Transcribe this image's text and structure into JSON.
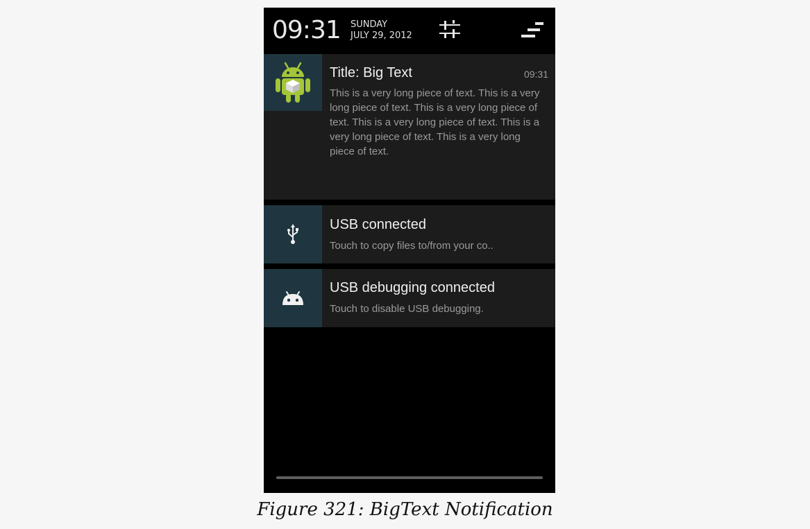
{
  "status_header": {
    "time": "09:31",
    "day": "SUNDAY",
    "date": "JULY 29, 2012",
    "settings_icon": "quick-settings-sliders-icon",
    "clear_icon": "clear-all-icon"
  },
  "notifications": [
    {
      "icon": "android-app-icon",
      "title": "Title: Big Text",
      "time": "09:31",
      "text": "This is a very long piece of text. This is a very long piece of text. This is a very long piece of text. This is a very long piece of text. This is a very long piece of text. This is a very long piece of text."
    },
    {
      "icon": "usb-icon",
      "title": "USB connected",
      "text": "Touch to copy files to/from your co.."
    },
    {
      "icon": "android-debug-icon",
      "title": "USB debugging connected",
      "text": "Touch to disable USB debugging."
    }
  ],
  "caption": "Figure 321: BigText Notification",
  "colors": {
    "notification_bg": "#1c1c1c",
    "icon_bg": "#1f3640",
    "android_green": "#a4c639"
  }
}
